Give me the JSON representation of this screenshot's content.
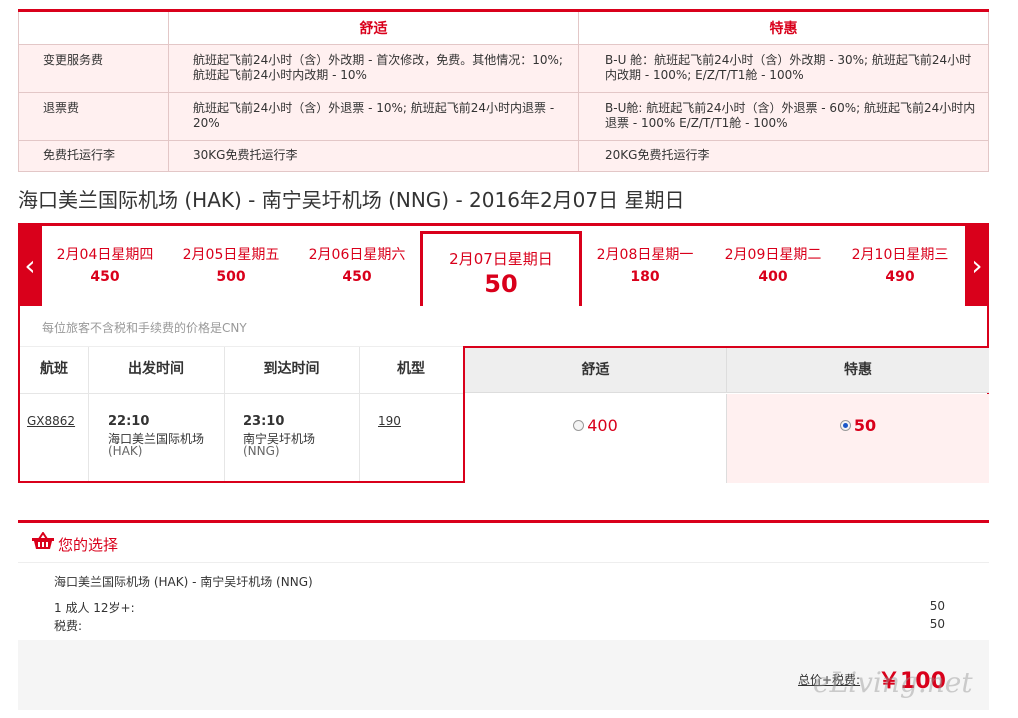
{
  "fees": {
    "col_comfort": "舒适",
    "col_special": "特惠",
    "rows": [
      {
        "label": "变更服务费",
        "comfort": "航班起飞前24小时（含）外改期 - 首次修改，免费。其他情况：10%; 航班起飞前24小时内改期 - 10%",
        "special": "B-U 舱：航班起飞前24小时（含）外改期 - 30%; 航班起飞前24小时内改期 - 100%; E/Z/T/T1舱 - 100%"
      },
      {
        "label": "退票费",
        "comfort": "航班起飞前24小时（含）外退票 - 10%; 航班起飞前24小时内退票 - 20%",
        "special": "B-U舱: 航班起飞前24小时（含）外退票 - 60%; 航班起飞前24小时内退票 - 100% E/Z/T/T1舱 - 100%"
      },
      {
        "label": "免费托运行李",
        "comfort": "30KG免费托运行李",
        "special": "20KG免费托运行李"
      }
    ]
  },
  "route_title": "海口美兰国际机场 (HAK) - 南宁吴圩机场 (NNG) - 2016年2月07日 星期日",
  "dates": [
    {
      "date": "2月04日星期四",
      "price": "450"
    },
    {
      "date": "2月05日星期五",
      "price": "500"
    },
    {
      "date": "2月06日星期六",
      "price": "450"
    },
    {
      "date": "2月07日星期日",
      "price": "50"
    },
    {
      "date": "2月08日星期一",
      "price": "180"
    },
    {
      "date": "2月09日星期二",
      "price": "400"
    },
    {
      "date": "2月10日星期三",
      "price": "490"
    }
  ],
  "arrows": {
    "prev": "‹",
    "next": "›"
  },
  "flights": {
    "note": "每位旅客不含税和手续费的价格是CNY",
    "headers": {
      "flight": "航班",
      "depart": "出发时间",
      "arrive": "到达时间",
      "aircraft": "机型",
      "comfort": "舒适",
      "special": "特惠"
    },
    "row": {
      "flight_no": "GX8862",
      "dep_time": "22:10",
      "dep_airport": "海口美兰国际机场",
      "dep_code": "(HAK)",
      "arr_time": "23:10",
      "arr_airport": "南宁吴圩机场",
      "arr_code": "(NNG)",
      "aircraft": "190",
      "comfort_price": "400",
      "special_price": "50"
    }
  },
  "selection": {
    "title": "您的选择",
    "route": "海口美兰国际机场 (HAK) - 南宁吴圩机场 (NNG)",
    "pax_label": "1 成人 12岁+:",
    "pax_value": "50",
    "tax_label": "税费:",
    "tax_value": "50",
    "total_label": "总价+税费:",
    "total_value": "￥100"
  },
  "watermark": "eLiving.net",
  "colors": {
    "accent": "#d9001b"
  }
}
